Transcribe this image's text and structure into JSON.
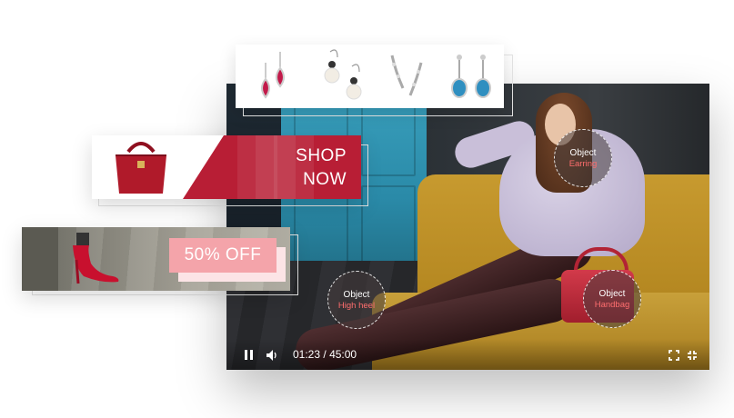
{
  "player": {
    "time_current": "01:23",
    "time_separator": "/",
    "time_total": "45:00",
    "hotspots": [
      {
        "label": "Object",
        "category": "Earring"
      },
      {
        "label": "Object",
        "category": "High heel"
      },
      {
        "label": "Object",
        "category": "Handbag"
      }
    ]
  },
  "banners": {
    "shop_now": {
      "line1": "SHOP",
      "line2": "NOW",
      "product_icon": "handbag-icon"
    },
    "discount": {
      "text": "50% OFF",
      "product_icon": "high-heel-icon"
    },
    "earrings": {
      "items": [
        "ruby-teardrop-earrings",
        "pearl-drop-earrings",
        "crystal-vine-earrings",
        "blue-crystal-earrings"
      ]
    }
  },
  "colors": {
    "accent_red": "#b81e35",
    "discount_pink": "#f4a4aa",
    "hotspot_category": "#ff6e6e"
  }
}
